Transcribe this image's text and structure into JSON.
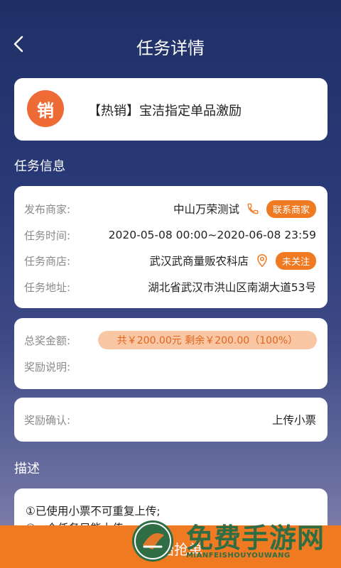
{
  "header": {
    "title": "任务详情"
  },
  "task": {
    "badge": "销",
    "title": "【热销】宝洁指定单品激励"
  },
  "sections": {
    "task_info": "任务信息",
    "description": "描述"
  },
  "info": {
    "merchant_label": "发布商家:",
    "merchant_value": "中山万荣测试",
    "contact_button": "联系商家",
    "time_label": "任务时间:",
    "time_value": "2020-05-08 00:00~2020-06-08 23:59",
    "store_label": "任务商店:",
    "store_value": "武汉武商量贩农科店",
    "follow_button": "未关注",
    "address_label": "任务地址:",
    "address_value": "湖北省武汉市洪山区南湖大道53号"
  },
  "reward": {
    "total_label": "总奖金额:",
    "total_value": "共￥200.00元 剩余￥200.00（100%）",
    "desc_label": "奖励说明:"
  },
  "confirm": {
    "label": "奖励确认:",
    "action": "上传小票"
  },
  "description": {
    "line1": "①已使用小票不可重复上传;",
    "line2": "②一个任务只能上传..."
  },
  "bottom": {
    "button": "开始抢单"
  },
  "watermark": {
    "title": "免费手游网",
    "subtitle": "MIANFEISHOUYOUWANG"
  },
  "colors": {
    "accent": "#ef7a22",
    "badge": "#ef6b36",
    "pill_bg": "#f9c7a4"
  }
}
